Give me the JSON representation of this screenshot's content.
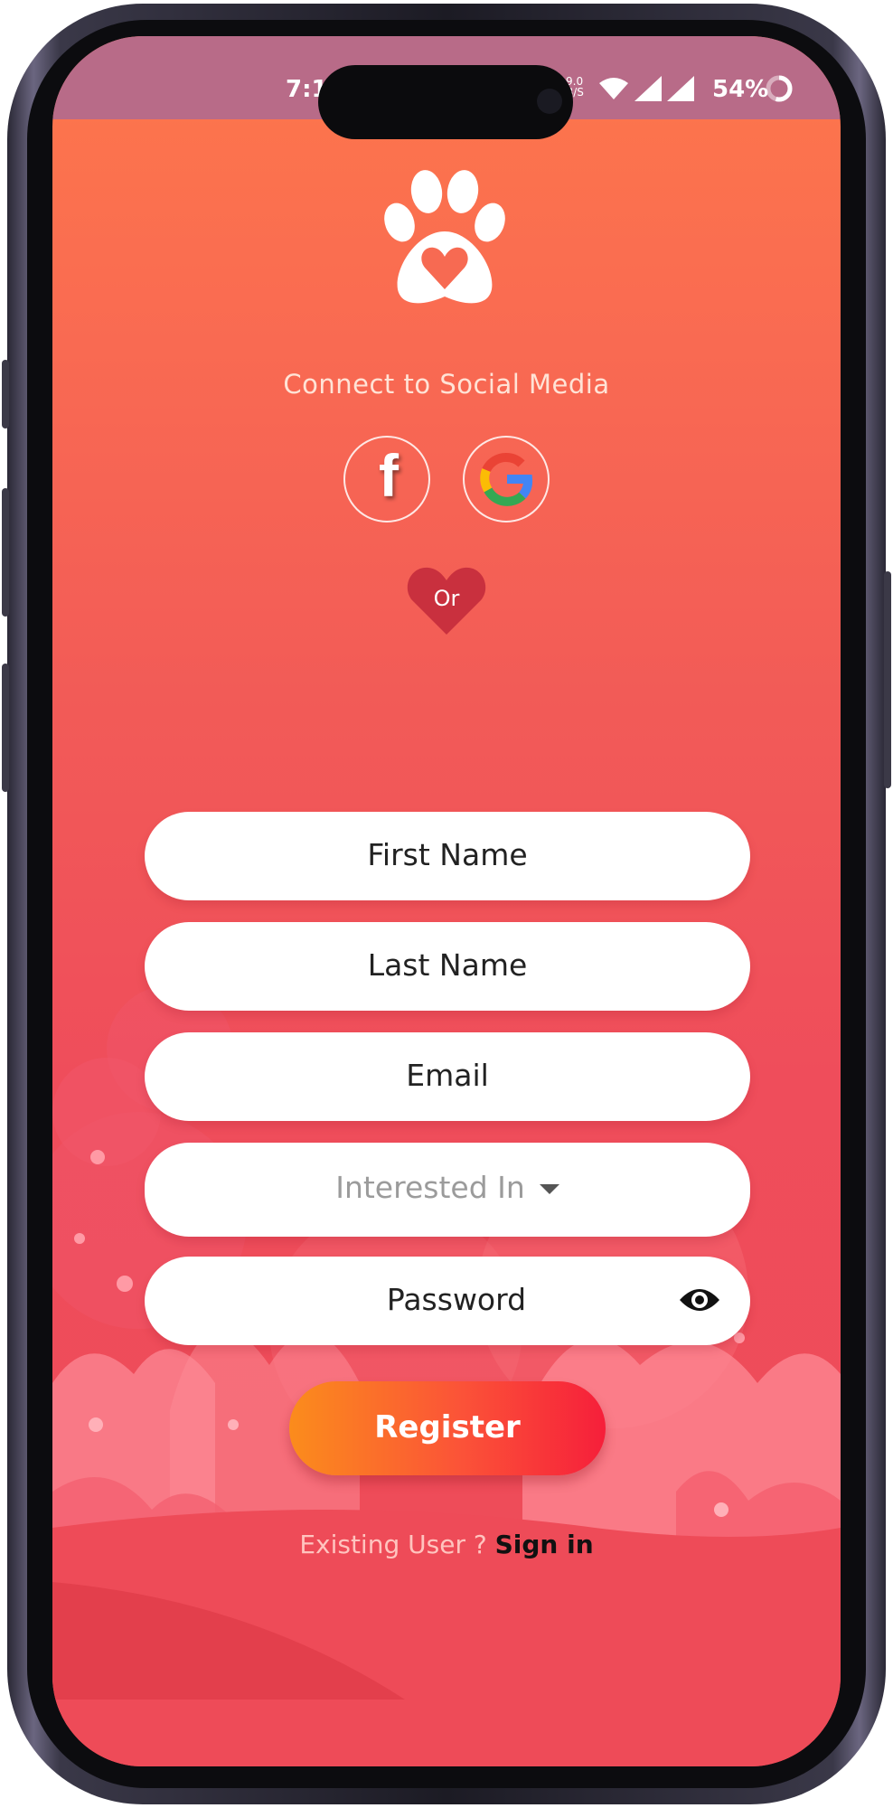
{
  "status_bar": {
    "time": "7:1",
    "network_speed": "9.0 B/S",
    "battery": "54%"
  },
  "social": {
    "caption": "Connect to Social Media",
    "facebook_glyph": "f",
    "separator": "Or"
  },
  "form": {
    "first_name_placeholder": "First Name",
    "last_name_placeholder": "Last Name",
    "email_placeholder": "Email",
    "interested_in_placeholder": "Interested In",
    "password_placeholder": "Password"
  },
  "actions": {
    "register_label": "Register",
    "existing_user_prompt": "Existing User ?",
    "sign_in_label": "Sign in"
  },
  "icons": {
    "logo": "paw-heart-icon",
    "facebook": "facebook-icon",
    "google": "google-icon",
    "separator": "heart-icon",
    "dropdown": "caret-down-icon",
    "password_toggle": "eye-icon"
  },
  "colors": {
    "background_top": "#fd774b",
    "background_bottom": "#ee4b58",
    "status_bar": "#b86b88",
    "register_gradient_start": "#fb8c1c",
    "register_gradient_end": "#f61f3a",
    "or_heart": "#c9303e"
  }
}
